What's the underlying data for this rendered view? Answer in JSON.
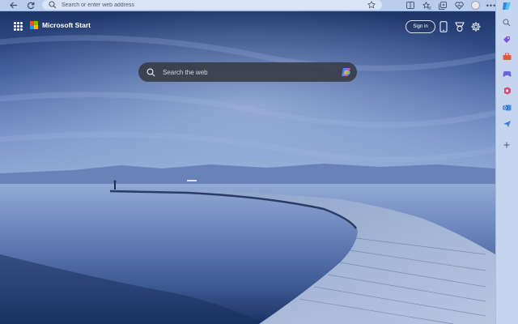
{
  "browser": {
    "address_placeholder": "Search or enter web address"
  },
  "page": {
    "brand_name": "Microsoft Start",
    "signin_label": "Sign in",
    "search_placeholder": "Search the web"
  },
  "icons": {
    "back": "arrow-left-icon",
    "refresh": "refresh-icon",
    "favorites": "star-icon",
    "apps": "grid-icon",
    "copilot": "copilot-icon"
  },
  "colors": {
    "ms_red": "#f25022",
    "ms_green": "#7fba00",
    "ms_blue": "#00a4ef",
    "ms_yellow": "#ffb900"
  }
}
